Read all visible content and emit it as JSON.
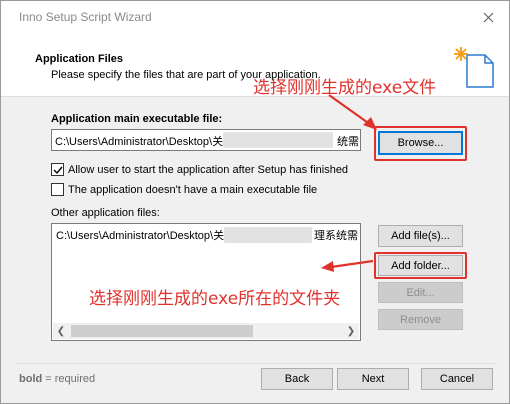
{
  "window": {
    "title": "Inno Setup Script Wizard"
  },
  "header": {
    "title": "Application Files",
    "description": "Please specify the files that are part of your application."
  },
  "main_exe": {
    "label": "Application main executable file:",
    "value": "C:\\Users\\Administrator\\Desktop\\关",
    "value_tail": "统需",
    "browse_label": "Browse..."
  },
  "options": {
    "allow_start": {
      "label": "Allow user to start the application after Setup has finished",
      "checked": true
    },
    "no_main_exe": {
      "label": "The application doesn't have a main executable file",
      "checked": false
    }
  },
  "other_files": {
    "label": "Other application files:",
    "items": [
      {
        "path": "C:\\Users\\Administrator\\Desktop\\关",
        "tail": "理系统需"
      }
    ],
    "add_files_label": "Add file(s)...",
    "add_folder_label": "Add folder...",
    "edit_label": "Edit...",
    "remove_label": "Remove"
  },
  "footer": {
    "note_bold": "bold",
    "note_rest": " = required",
    "back_label": "Back",
    "next_label": "Next",
    "cancel_label": "Cancel"
  },
  "annotations": {
    "exe": "选择刚刚生成的exe文件",
    "folder": "选择刚刚生成的exe所在的文件夹",
    "color": "#e0322d"
  }
}
